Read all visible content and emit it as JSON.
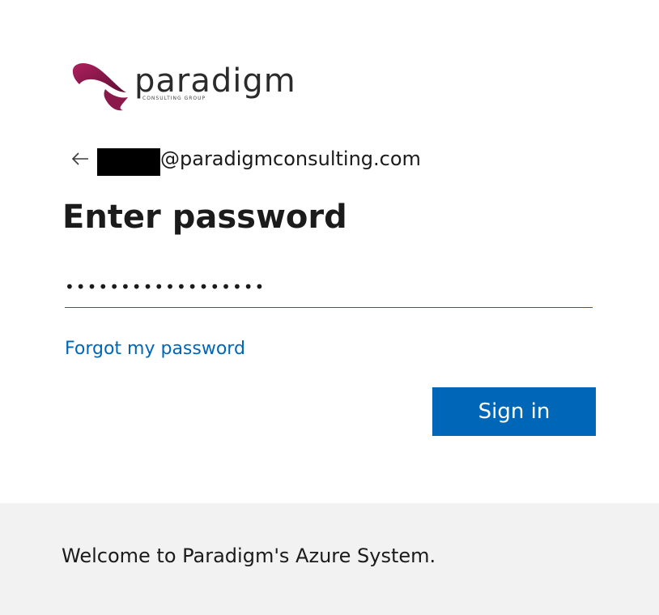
{
  "logo": {
    "word": "paradigm",
    "subtitle": "CONSULTING GROUP",
    "icon": "paradigm-swoosh-logo",
    "brand_color": "#8a1a4b"
  },
  "identity": {
    "email": "@paradigmconsulting.com",
    "back_icon": "arrow-left-icon"
  },
  "heading": "Enter password",
  "password": {
    "masked_value": "••••••••••••••••••",
    "type": "password"
  },
  "forgot_link": "Forgot my password",
  "signin_label": "Sign in",
  "footer_text": "Welcome to Paradigm's Azure System.",
  "colors": {
    "accent": "#0067b8",
    "footer_bg": "#f2f2f2",
    "text": "#1b1b1b"
  }
}
